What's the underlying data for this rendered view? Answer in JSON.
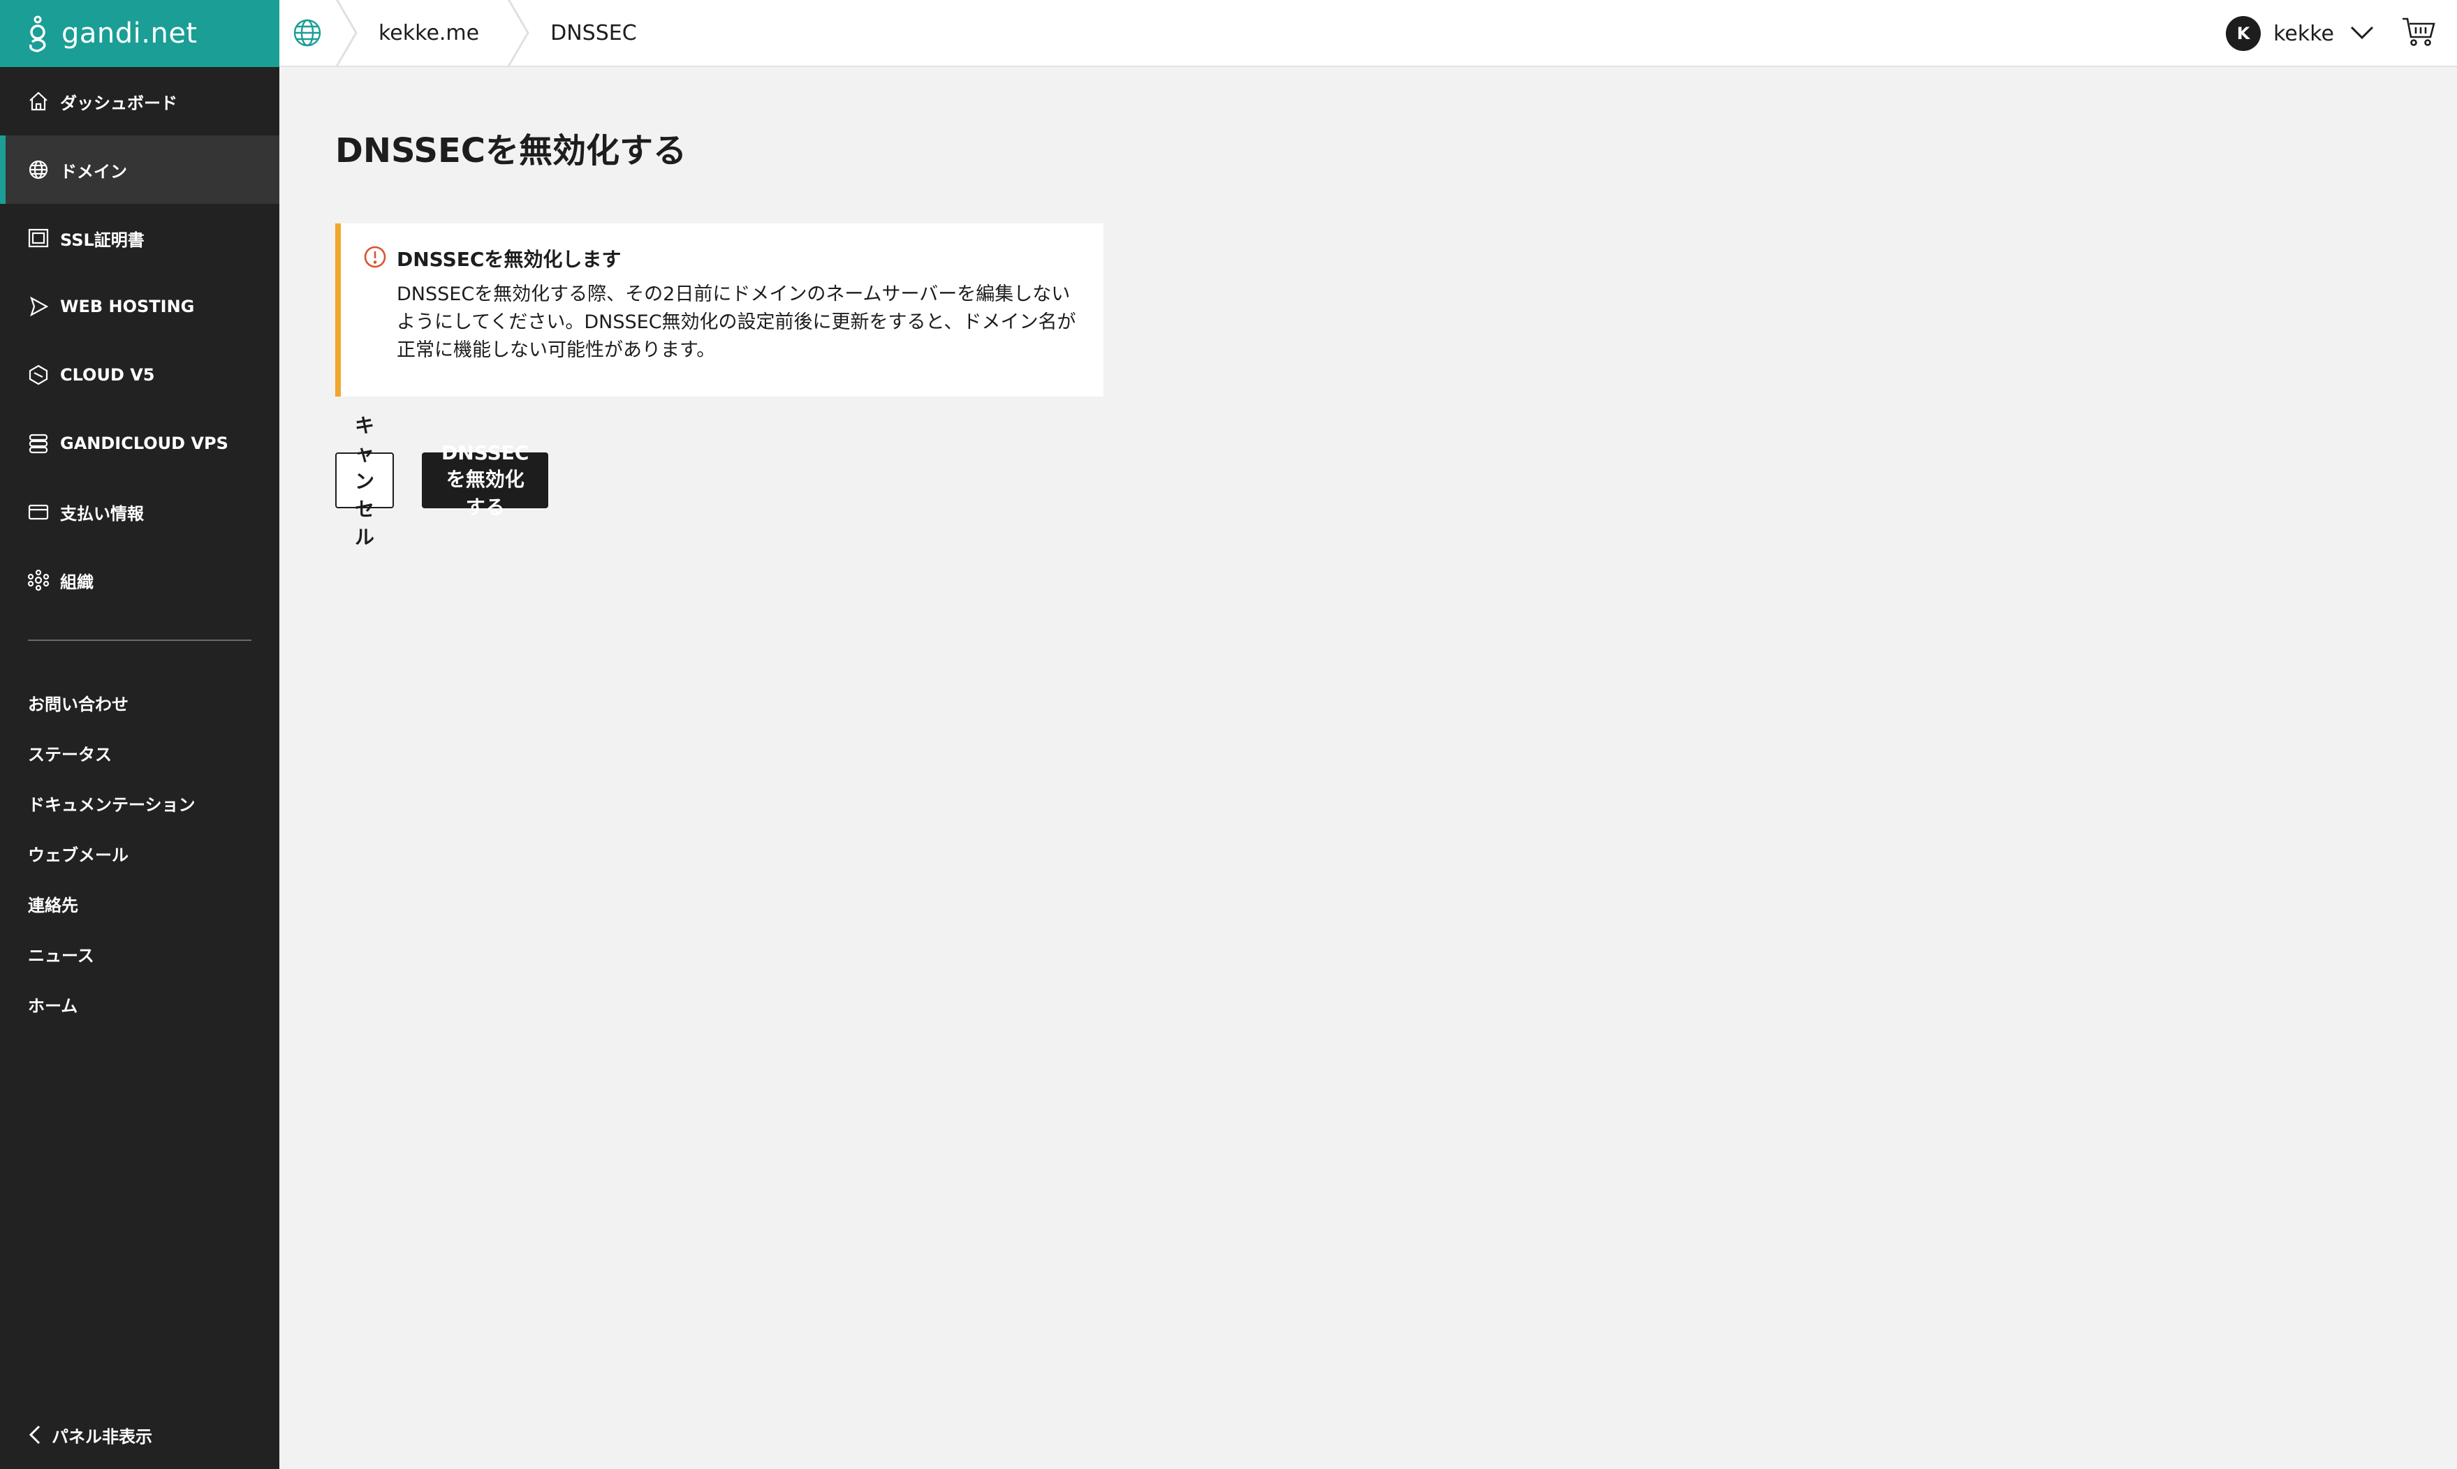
{
  "brand": {
    "name": "gandi.net",
    "accent": "#1a9e96"
  },
  "sidebar": {
    "items": [
      {
        "label": "ダッシュボード",
        "icon": "home-icon"
      },
      {
        "label": "ドメイン",
        "icon": "globe-icon",
        "active": true
      },
      {
        "label": "SSL証明書",
        "icon": "certificate-icon"
      },
      {
        "label": "WEB HOSTING",
        "icon": "play-icon"
      },
      {
        "label": "CLOUD V5",
        "icon": "hexagon-icon"
      },
      {
        "label": "GANDICLOUD VPS",
        "icon": "server-stack-icon"
      },
      {
        "label": "支払い情報",
        "icon": "credit-card-icon"
      },
      {
        "label": "組織",
        "icon": "network-icon"
      }
    ],
    "links": [
      {
        "label": "お問い合わせ"
      },
      {
        "label": "ステータス"
      },
      {
        "label": "ドキュメンテーション"
      },
      {
        "label": "ウェブメール"
      },
      {
        "label": "連絡先"
      },
      {
        "label": "ニュース"
      },
      {
        "label": "ホーム"
      }
    ],
    "collapse_label": "パネル非表示"
  },
  "header": {
    "breadcrumb": [
      "kekke.me",
      "DNSSEC"
    ],
    "user": {
      "initial": "K",
      "name": "kekke"
    }
  },
  "main": {
    "title": "DNSSECを無効化する",
    "alert": {
      "title": "DNSSECを無効化します",
      "body": "DNSSECを無効化する際、その2日前にドメインのネームサーバーを編集しないようにしてください。DNSSEC無効化の設定前後に更新をすると、ドメイン名が正常に機能しない可能性があります。",
      "color": "#f0a72f"
    },
    "buttons": {
      "cancel": "キャンセル",
      "confirm": "DNSSECを無効化する"
    }
  }
}
